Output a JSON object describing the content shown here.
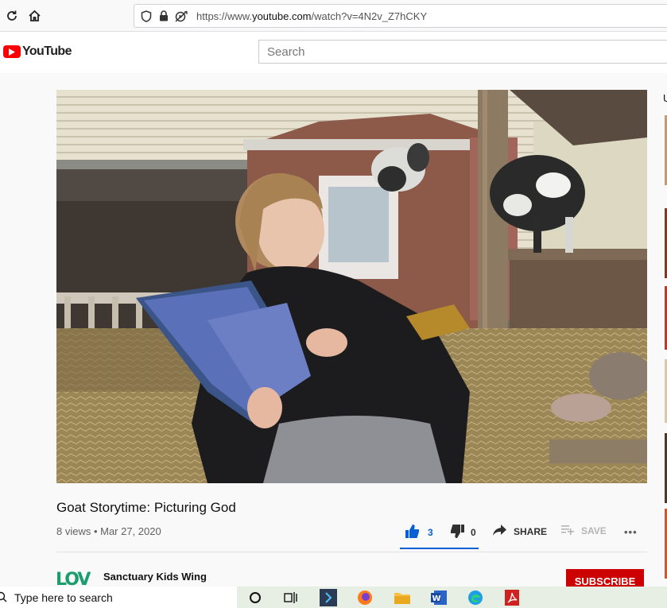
{
  "browser": {
    "url_prefix": "https://www.",
    "url_domain": "youtube.com",
    "url_path": "/watch?v=4N2v_Z7hCKY"
  },
  "youtube": {
    "logo_text": "YouTube",
    "search_placeholder": "Search"
  },
  "video": {
    "title": "Goat Storytime: Picturing God",
    "meta": "8 views • Mar 27, 2020"
  },
  "actions": {
    "likes": "3",
    "dislikes": "0",
    "share_label": "SHARE",
    "save_label": "SAVE",
    "more_label": "•••"
  },
  "channel": {
    "name": "Sanctuary Kids Wing",
    "logo_text": "LOVE",
    "subscribe_label": "SUBSCRIBE"
  },
  "sidebar": {
    "partial_letter": "U"
  },
  "taskbar": {
    "search_placeholder": "Type here to search"
  },
  "colors": {
    "youtube_red": "#ff0000",
    "subscribe_red": "#cc0000",
    "like_blue": "#065fd4"
  }
}
